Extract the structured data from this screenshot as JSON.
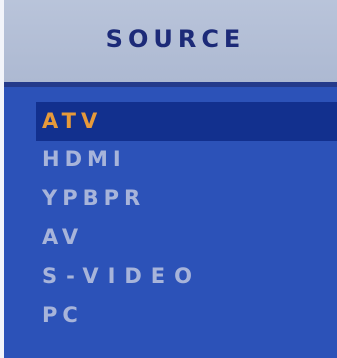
{
  "header": {
    "title": "SOURCE"
  },
  "menu": {
    "selected_index": 0,
    "items": [
      {
        "label": "ATV"
      },
      {
        "label": "HDMI"
      },
      {
        "label": "YPBPR"
      },
      {
        "label": "AV"
      },
      {
        "label": "S-VIDEO"
      },
      {
        "label": "PC"
      }
    ]
  },
  "colors": {
    "header_background": "#b3bed6",
    "header_text": "#1c2a78",
    "panel_background": "#2c52b8",
    "selected_background": "#12308e",
    "selected_text": "#e79a3a",
    "item_text": "#a7b4da"
  }
}
